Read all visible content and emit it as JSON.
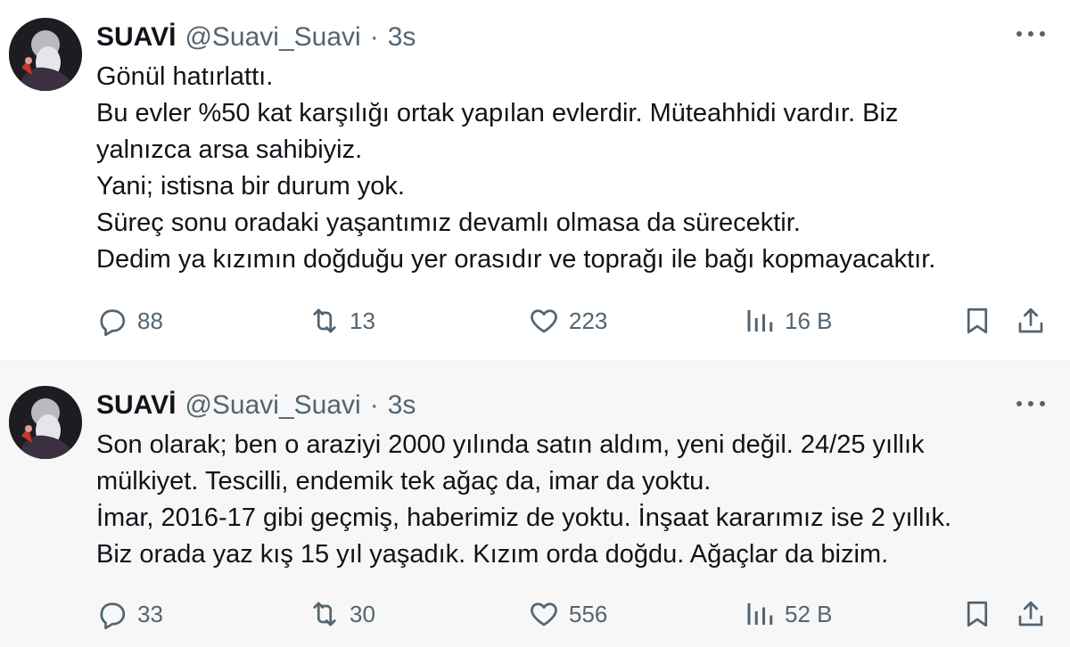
{
  "tweets": [
    {
      "author": {
        "name": "SUAVİ",
        "handle": "@Suavi_Suavi",
        "separator": "·",
        "time": "3s"
      },
      "lines": [
        "Gönül hatırlattı.",
        "Bu evler %50 kat karşılığı ortak yapılan evlerdir. Müteahhidi vardır. Biz",
        "yalnızca arsa sahibiyiz.",
        "Yani; istisna bir durum yok.",
        "Süreç sonu oradaki yaşantımız devamlı olmasa da sürecektir.",
        "Dedim ya kızımın doğduğu yer orasıdır ve toprağı ile bağı kopmayacaktır."
      ],
      "stats": {
        "replies": "88",
        "reposts": "13",
        "likes": "223",
        "views": "16 B"
      }
    },
    {
      "author": {
        "name": "SUAVİ",
        "handle": "@Suavi_Suavi",
        "separator": "·",
        "time": "3s"
      },
      "lines": [
        "Son olarak; ben o araziyi 2000 yılında satın aldım, yeni değil. 24/25 yıllık",
        "mülkiyet. Tescilli, endemik tek ağaç da, imar da yoktu.",
        "İmar, 2016-17 gibi geçmiş, haberimiz de yoktu. İnşaat kararımız ise 2 yıllık.",
        "Biz orada yaz kış 15 yıl yaşadık. Kızım orda doğdu. Ağaçlar da bizim."
      ],
      "stats": {
        "replies": "33",
        "reposts": "30",
        "likes": "556",
        "views": "52 B"
      }
    }
  ],
  "icons": {
    "reply": "speech-bubble-icon",
    "repost": "repost-arrows-icon",
    "like": "heart-icon",
    "views": "bar-chart-icon",
    "bookmark": "bookmark-icon",
    "share": "share-upload-icon",
    "more": "more-dots-icon"
  },
  "colors": {
    "text": "#0f1419",
    "secondary": "#536471",
    "alt_background": "#f7f7f7"
  }
}
